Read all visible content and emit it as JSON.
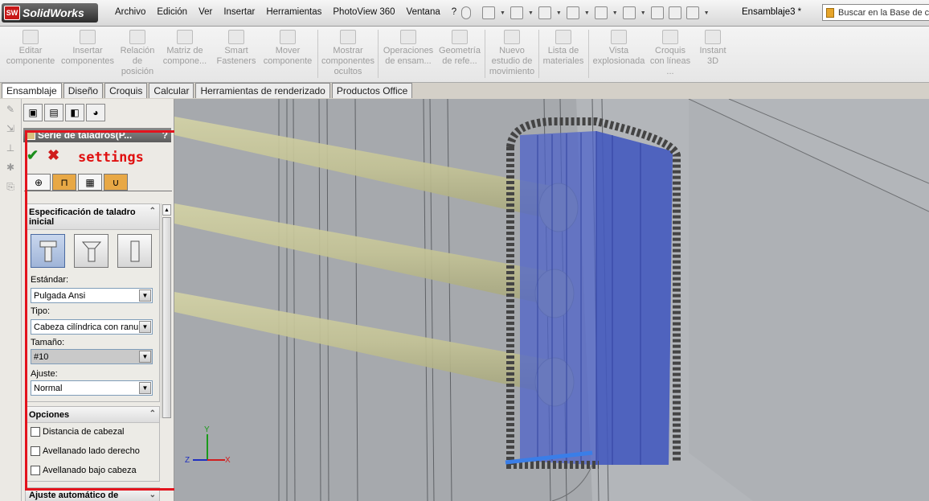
{
  "app": {
    "logo_badge": "SW",
    "brand": "SolidWorks",
    "document": "Ensamblaje3 *"
  },
  "menu": [
    "Archivo",
    "Edición",
    "Ver",
    "Insertar",
    "Herramientas",
    "PhotoView 360",
    "Ventana",
    "?"
  ],
  "search": {
    "placeholder": "Buscar en la Base de c"
  },
  "ribbon": [
    {
      "label": "Editar componente",
      "icon": "edit-component-icon"
    },
    {
      "label": "Insertar componentes",
      "icon": "insert-components-icon"
    },
    {
      "label": "Relación de posición",
      "icon": "mate-icon"
    },
    {
      "label": "Matriz de compone...",
      "icon": "pattern-icon"
    },
    {
      "label": "Smart Fasteners",
      "icon": "fasteners-icon"
    },
    {
      "label": "Mover componente",
      "icon": "move-icon"
    },
    {
      "label": "Mostrar componentes ocultos",
      "icon": "show-hidden-icon"
    },
    {
      "label": "Operaciones de ensam...",
      "icon": "assembly-features-icon"
    },
    {
      "label": "Geometría de refe...",
      "icon": "reference-geometry-icon"
    },
    {
      "label": "Nuevo estudio de movimiento",
      "icon": "motion-study-icon"
    },
    {
      "label": "Lista de materiales",
      "icon": "bom-icon"
    },
    {
      "label": "Vista explosionada",
      "icon": "exploded-view-icon"
    },
    {
      "label": "Croquis con líneas ...",
      "icon": "sketch-lines-icon"
    },
    {
      "label": "Instant 3D",
      "icon": "instant3d-icon"
    }
  ],
  "tabs": [
    "Ensamblaje",
    "Diseño",
    "Croquis",
    "Calcular",
    "Herramientas de renderizado",
    "Productos Office"
  ],
  "pm": {
    "title": "Serie de taladros(P...",
    "help": "?",
    "annotation": "settings",
    "initial_spec": {
      "heading": "Especificación de taladro inicial",
      "standard_label": "Estándar:",
      "standard_value": "Pulgada Ansi",
      "type_label": "Tipo:",
      "type_value": "Cabeza cilíndrica con ranura",
      "size_label": "Tamaño:",
      "size_value": "#10",
      "fit_label": "Ajuste:",
      "fit_value": "Normal"
    },
    "options": {
      "heading": "Opciones",
      "items": [
        "Distancia de cabezal",
        "Avellanado lado derecho",
        "Avellanado bajo cabeza"
      ]
    },
    "auto_fit": {
      "heading": "Ajuste automático de"
    }
  },
  "axis": {
    "x": "X",
    "y": "Y",
    "z": "Z"
  }
}
